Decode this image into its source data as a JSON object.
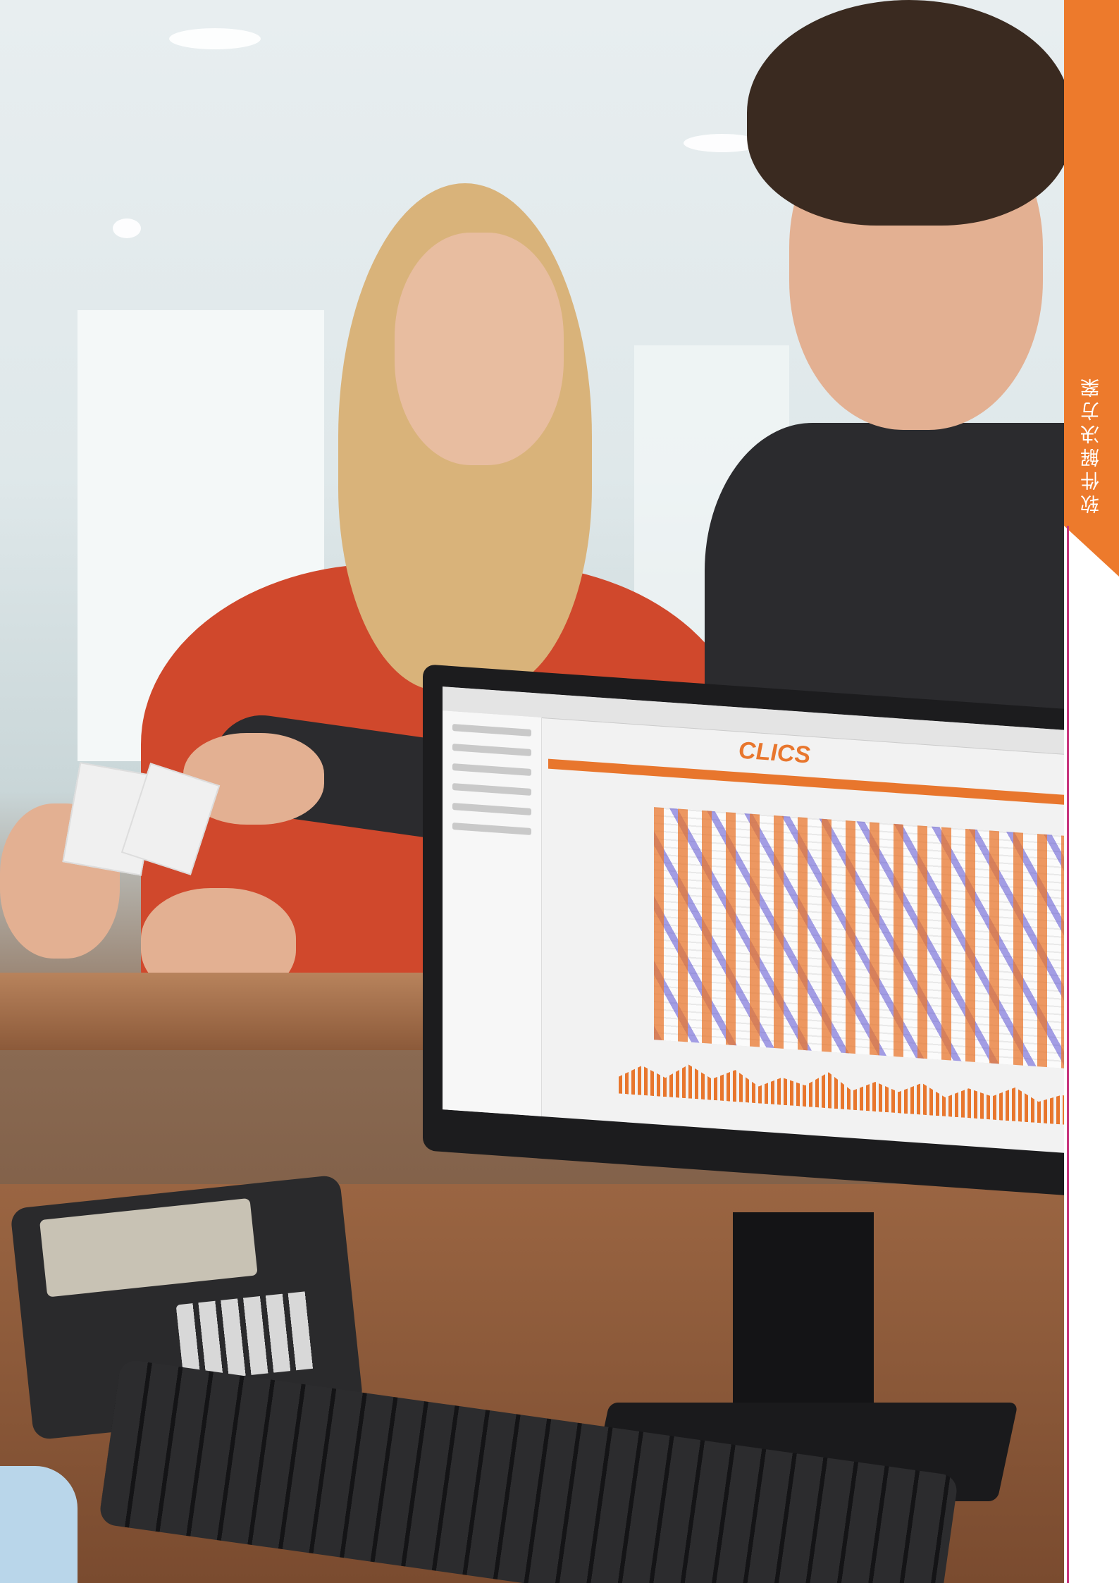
{
  "side_tab": {
    "label": "软件解决方案",
    "color": "#ed7a2c"
  },
  "accent_rule_color": "#c8357d",
  "monitor": {
    "app_logo": "CLICS",
    "accent_color": "#e8762d"
  }
}
